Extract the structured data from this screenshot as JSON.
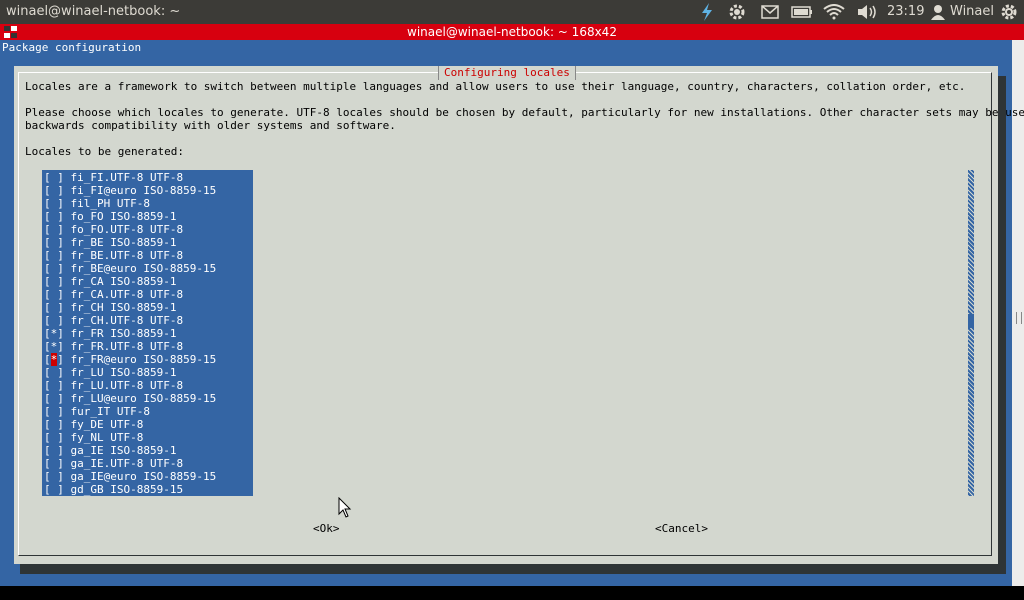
{
  "panel": {
    "title": "winael@winael-netbook: ~",
    "clock": "23:19",
    "user": "Winael",
    "icons": [
      "lightning-icon",
      "settings-icon",
      "mail-icon",
      "battery-icon",
      "wifi-icon",
      "volume-icon",
      "user-icon",
      "power-icon"
    ]
  },
  "window": {
    "title": "winael@winael-netbook: ~ 168x42"
  },
  "terminal": {
    "header": "Package configuration",
    "dialog": {
      "title": "Configuring locales",
      "line1": "Locales are a framework to switch between multiple languages and allow users to use their language, country, characters, collation order, etc.",
      "line2": "Please choose which locales to generate. UTF-8 locales should be chosen by default, particularly for new installations. Other character sets may be useful for",
      "line3": "backwards compatibility with older systems and software.",
      "prompt": "Locales to be generated:",
      "locales": [
        {
          "mark": "[ ]",
          "name": "fi_FI.UTF-8 UTF-8"
        },
        {
          "mark": "[ ]",
          "name": "fi_FI@euro ISO-8859-15"
        },
        {
          "mark": "[ ]",
          "name": "fil_PH UTF-8"
        },
        {
          "mark": "[ ]",
          "name": "fo_FO ISO-8859-1"
        },
        {
          "mark": "[ ]",
          "name": "fo_FO.UTF-8 UTF-8"
        },
        {
          "mark": "[ ]",
          "name": "fr_BE ISO-8859-1"
        },
        {
          "mark": "[ ]",
          "name": "fr_BE.UTF-8 UTF-8"
        },
        {
          "mark": "[ ]",
          "name": "fr_BE@euro ISO-8859-15"
        },
        {
          "mark": "[ ]",
          "name": "fr_CA ISO-8859-1"
        },
        {
          "mark": "[ ]",
          "name": "fr_CA.UTF-8 UTF-8"
        },
        {
          "mark": "[ ]",
          "name": "fr_CH ISO-8859-1"
        },
        {
          "mark": "[ ]",
          "name": "fr_CH.UTF-8 UTF-8"
        },
        {
          "mark": "[*]",
          "name": "fr_FR ISO-8859-1"
        },
        {
          "mark": "[*]",
          "name": "fr_FR.UTF-8 UTF-8"
        },
        {
          "mark": "[*]",
          "name": "fr_FR@euro ISO-8859-15",
          "cursor": true
        },
        {
          "mark": "[ ]",
          "name": "fr_LU ISO-8859-1"
        },
        {
          "mark": "[ ]",
          "name": "fr_LU.UTF-8 UTF-8"
        },
        {
          "mark": "[ ]",
          "name": "fr_LU@euro ISO-8859-15"
        },
        {
          "mark": "[ ]",
          "name": "fur_IT UTF-8"
        },
        {
          "mark": "[ ]",
          "name": "fy_DE UTF-8"
        },
        {
          "mark": "[ ]",
          "name": "fy_NL UTF-8"
        },
        {
          "mark": "[ ]",
          "name": "ga_IE ISO-8859-1"
        },
        {
          "mark": "[ ]",
          "name": "ga_IE.UTF-8 UTF-8"
        },
        {
          "mark": "[ ]",
          "name": "ga_IE@euro ISO-8859-15"
        },
        {
          "mark": "[ ]",
          "name": "gd_GB ISO-8859-15"
        }
      ],
      "ok_label": "<Ok>",
      "cancel_label": "<Cancel>"
    }
  },
  "colors": {
    "panel": "#3c3b37",
    "window_bar": "#d7000f",
    "terminal_bg": "#3465a4",
    "dialog_bg": "#d3d7cf",
    "dialog_title": "#cc0000"
  }
}
